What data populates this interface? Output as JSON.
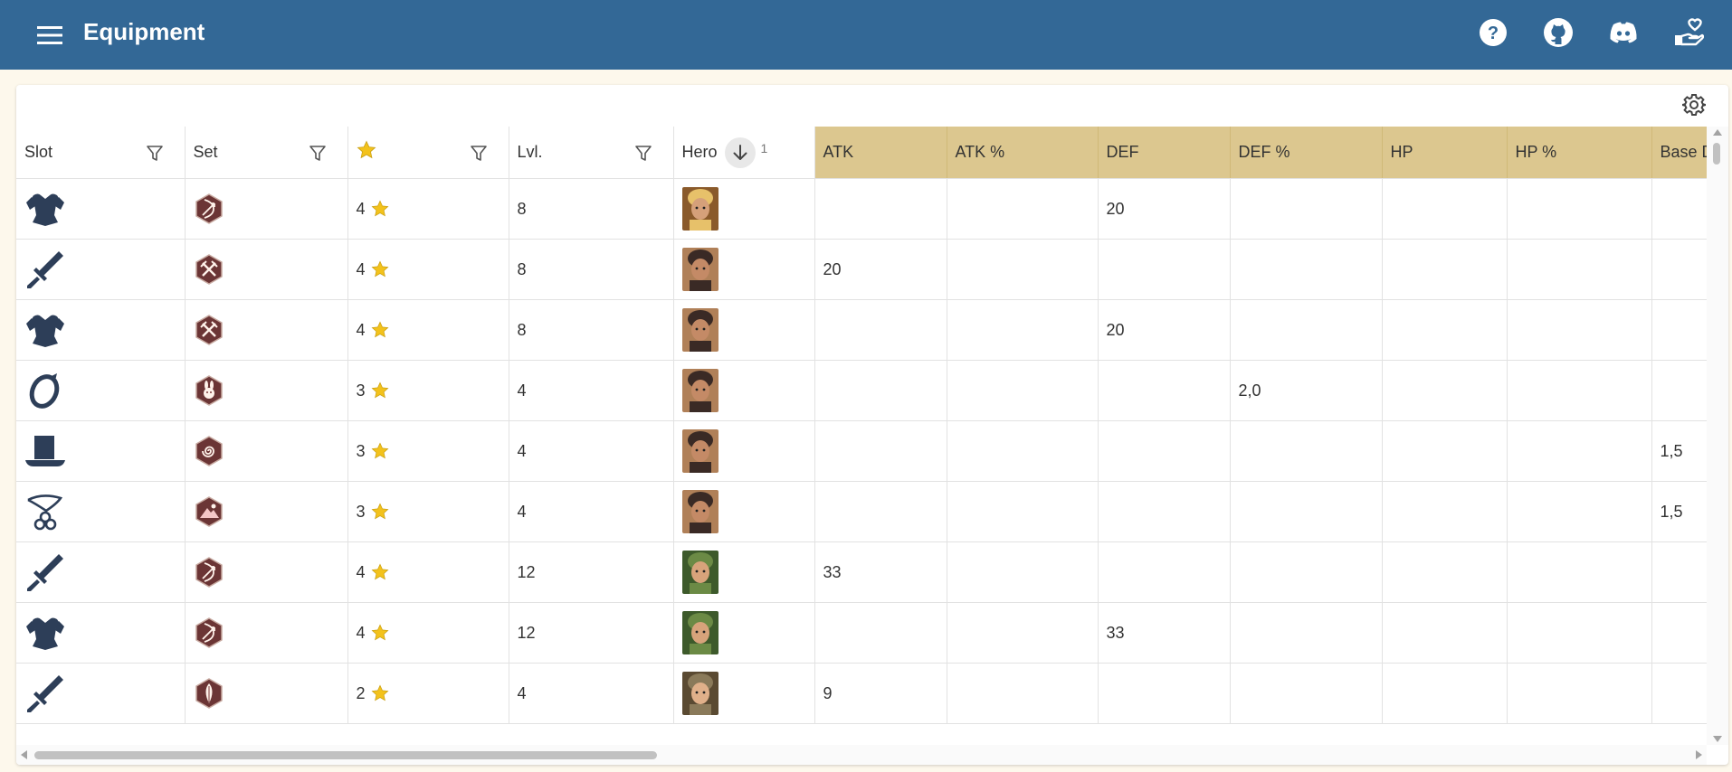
{
  "appbar": {
    "title": "Equipment",
    "color": "#336896",
    "icons": [
      "help-icon",
      "github-icon",
      "discord-icon",
      "donate-icon"
    ]
  },
  "table": {
    "header_color": "#dcc78f",
    "columns": {
      "slot": "Slot",
      "set": "Set",
      "rarity_icon": "star-icon",
      "level": "Lvl.",
      "hero": "Hero",
      "hero_sort_order": "1",
      "atk": "ATK",
      "atk_pct": "ATK %",
      "def": "DEF",
      "def_pct": "DEF %",
      "hp": "HP",
      "hp_pct": "HP %",
      "base": "Base D"
    },
    "rows": [
      {
        "slot": "armor-icon",
        "set": "bow-set-icon",
        "rarity": "4",
        "level": "8",
        "hero": "hero-portrait-1",
        "atk": "",
        "atk_pct": "",
        "def": "20",
        "def_pct": "",
        "hp": "",
        "hp_pct": "",
        "base": ""
      },
      {
        "slot": "sword-icon",
        "set": "crossed-swords-set-icon",
        "rarity": "4",
        "level": "8",
        "hero": "hero-portrait-2",
        "atk": "20",
        "atk_pct": "",
        "def": "",
        "def_pct": "",
        "hp": "",
        "hp_pct": "",
        "base": ""
      },
      {
        "slot": "armor-icon",
        "set": "crossed-swords-set-icon",
        "rarity": "4",
        "level": "8",
        "hero": "hero-portrait-2",
        "atk": "",
        "atk_pct": "",
        "def": "20",
        "def_pct": "",
        "hp": "",
        "hp_pct": "",
        "base": ""
      },
      {
        "slot": "ring-icon",
        "set": "rabbit-set-icon",
        "rarity": "3",
        "level": "4",
        "hero": "hero-portrait-2",
        "atk": "",
        "atk_pct": "",
        "def": "",
        "def_pct": "2,0",
        "hp": "",
        "hp_pct": "",
        "base": ""
      },
      {
        "slot": "hat-icon",
        "set": "swirl-set-icon",
        "rarity": "3",
        "level": "4",
        "hero": "hero-portrait-2",
        "atk": "",
        "atk_pct": "",
        "def": "",
        "def_pct": "",
        "hp": "",
        "hp_pct": "",
        "base": "1,5"
      },
      {
        "slot": "amulet-icon",
        "set": "mountain-set-icon",
        "rarity": "3",
        "level": "4",
        "hero": "hero-portrait-2",
        "atk": "",
        "atk_pct": "",
        "def": "",
        "def_pct": "",
        "hp": "",
        "hp_pct": "",
        "base": "1,5"
      },
      {
        "slot": "sword-icon",
        "set": "bow-set-icon",
        "rarity": "4",
        "level": "12",
        "hero": "hero-portrait-3",
        "atk": "33",
        "atk_pct": "",
        "def": "",
        "def_pct": "",
        "hp": "",
        "hp_pct": "",
        "base": ""
      },
      {
        "slot": "armor-icon",
        "set": "bow-set-icon",
        "rarity": "4",
        "level": "12",
        "hero": "hero-portrait-3",
        "atk": "",
        "atk_pct": "",
        "def": "33",
        "def_pct": "",
        "hp": "",
        "hp_pct": "",
        "base": ""
      },
      {
        "slot": "sword-icon",
        "set": "feather-set-icon",
        "rarity": "2",
        "level": "4",
        "hero": "hero-portrait-4",
        "atk": "9",
        "atk_pct": "",
        "def": "",
        "def_pct": "",
        "hp": "",
        "hp_pct": "",
        "base": ""
      }
    ]
  }
}
